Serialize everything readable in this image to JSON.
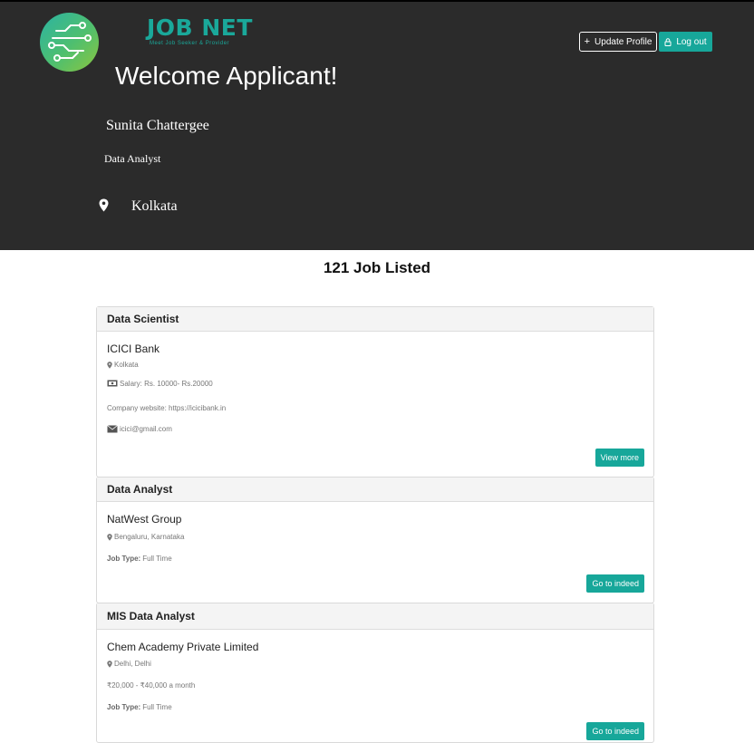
{
  "brand": {
    "name": "JOB NET",
    "tagline": "Meet Job Seeker & Provider"
  },
  "header": {
    "update_profile_label": "Update Profile",
    "logout_label": "Log out",
    "welcome": "Welcome Applicant!"
  },
  "applicant": {
    "name": "Sunita Chattergee",
    "role": "Data Analyst",
    "city": "Kolkata"
  },
  "listing": {
    "count_text": "121 Job Listed"
  },
  "jobs": [
    {
      "title": "Data Scientist",
      "company": "ICICI Bank",
      "location": "Kolkata",
      "salary": "Salary: Rs. 10000- Rs.20000",
      "website": "Company website: https://icicibank.in",
      "email": "icici@gmail.com",
      "action": "View more"
    },
    {
      "title": "Data Analyst",
      "company": "NatWest Group",
      "location": "Bengaluru, Karnataka",
      "job_type_label": "Job Type:",
      "job_type": "Full Time",
      "action": "Go to indeed"
    },
    {
      "title": "MIS Data Analyst",
      "company": "Chem Academy Private Limited",
      "location": "Delhi, Delhi",
      "salary": "₹20,000 - ₹40,000 a month",
      "job_type_label": "Job Type:",
      "job_type": "Full Time",
      "action": "Go to indeed"
    }
  ],
  "colors": {
    "hero_bg": "#2b2b2b",
    "accent": "#17a79a"
  }
}
